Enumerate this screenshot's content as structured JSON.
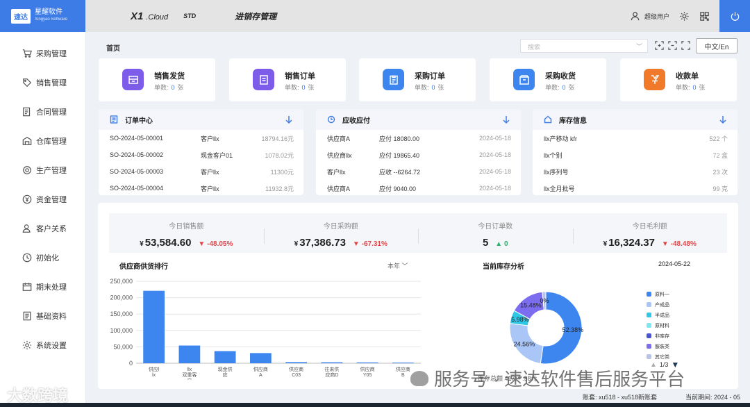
{
  "logo": {
    "badge": "速达",
    "name": "星耀软件",
    "tagline": "Xingyao Software"
  },
  "header": {
    "brand": "X1",
    "brand_suffix": ".Cloud",
    "edition": "STD",
    "module": "进销存管理",
    "user": "超级用户",
    "icons": [
      "user-icon",
      "gear-icon",
      "qrcode-icon",
      "power-icon"
    ]
  },
  "sidebar": {
    "items": [
      {
        "label": "采购管理",
        "icon": "cart-icon"
      },
      {
        "label": "销售管理",
        "icon": "tag-icon"
      },
      {
        "label": "合同管理",
        "icon": "contract-icon"
      },
      {
        "label": "仓库管理",
        "icon": "warehouse-icon"
      },
      {
        "label": "生产管理",
        "icon": "production-icon"
      },
      {
        "label": "资金管理",
        "icon": "money-icon"
      },
      {
        "label": "客户关系",
        "icon": "customer-icon"
      },
      {
        "label": "初始化",
        "icon": "init-icon"
      },
      {
        "label": "期末处理",
        "icon": "calendar-icon"
      },
      {
        "label": "基础资料",
        "icon": "document-icon"
      },
      {
        "label": "系统设置",
        "icon": "settings-icon"
      }
    ]
  },
  "breadcrumb": "首页",
  "search": {
    "placeholder": "搜索"
  },
  "language_button": "中文/En",
  "quick_cards": [
    {
      "title": "销售发货",
      "count_label": "单数:",
      "count": "0",
      "unit": "张",
      "color": "#7c5ce8"
    },
    {
      "title": "销售订单",
      "count_label": "单数:",
      "count": "0",
      "unit": "张",
      "color": "#7c5ce8"
    },
    {
      "title": "采购订单",
      "count_label": "单数:",
      "count": "0",
      "unit": "张",
      "color": "#3d86f0"
    },
    {
      "title": "采购收货",
      "count_label": "单数:",
      "count": "0",
      "unit": "张",
      "color": "#3d86f0"
    },
    {
      "title": "收款单",
      "count_label": "单数:",
      "count": "0",
      "unit": "张",
      "color": "#f0792a"
    }
  ],
  "panels": {
    "orders": {
      "title": "订单中心",
      "rows": [
        [
          "SO-2024-05-00001",
          "客户llx",
          "18794.16元"
        ],
        [
          "SO-2024-05-00002",
          "现金客户01",
          "1078.02元"
        ],
        [
          "SO-2024-05-00003",
          "客户llx",
          "11300元"
        ],
        [
          "SO-2024-05-00004",
          "客户llx",
          "11932.8元"
        ]
      ]
    },
    "receivables": {
      "title": "应收应付",
      "rows": [
        [
          "供应商A",
          "应付 18080.00",
          "2024-05-18"
        ],
        [
          "供应商llx",
          "应付 19865.40",
          "2024-05-18"
        ],
        [
          "客户llx",
          "应收 --6264.72",
          "2024-05-18"
        ],
        [
          "供应商A",
          "应付 9040.00",
          "2024-05-18"
        ]
      ]
    },
    "inventory": {
      "title": "库存信息",
      "rows": [
        [
          "llx产移动 kfr",
          "522 个"
        ],
        [
          "llx个别",
          "72 盒"
        ],
        [
          "llx序列号",
          "23 次"
        ],
        [
          "llx全月批号",
          "99 克"
        ]
      ]
    }
  },
  "stats": [
    {
      "label": "今日销售额",
      "currency": "¥",
      "value": "53,584.60",
      "change": "-48.05%",
      "direction": "down"
    },
    {
      "label": "今日采购额",
      "currency": "¥",
      "value": "37,386.73",
      "change": "-67.31%",
      "direction": "down"
    },
    {
      "label": "今日订单数",
      "currency": "",
      "value": "5",
      "change": "0",
      "direction": "up"
    },
    {
      "label": "今日毛利额",
      "currency": "¥",
      "value": "16,324.37",
      "change": "-48.48%",
      "direction": "down"
    }
  ],
  "supplier_chart_title": "供应商供货排行",
  "supplier_period": "本年",
  "inventory_chart_title": "当前库存分析",
  "inventory_date": "2024-05-22",
  "inventory_total": "库存总额 417***.98元",
  "legend_page": "1/3",
  "status_bar": {
    "account": "账套: xu518 - xu518新账套",
    "period": "当前期间: 2024 - 05"
  },
  "watermark": {
    "wechat": "服务号 · 速达软件售后服务平台",
    "source": "大数跨境"
  },
  "chart_data": [
    {
      "type": "bar",
      "title": "供应商供货排行",
      "categories": [
        "供应l lx",
        "llx 双重客户",
        "现金供应",
        "供应商 A",
        "供应商 C03",
        "往来供应商D",
        "供应商 Y05",
        "供应商 B"
      ],
      "category_lines": [
        [
          "供应l",
          "lx"
        ],
        [
          "llx",
          "双重客",
          "户"
        ],
        [
          "现金供",
          "应"
        ],
        [
          "供应商",
          "A"
        ],
        [
          "供应商",
          "C03"
        ],
        [
          "往来供",
          "应商D"
        ],
        [
          "供应商",
          "Y05"
        ],
        [
          "供应商",
          "B"
        ]
      ],
      "values": [
        221000,
        54000,
        37000,
        31000,
        3500,
        3000,
        2500,
        2000
      ],
      "y_ticks": [
        "0",
        "50,000",
        "100,000",
        "150,000",
        "200,000",
        "250,000"
      ],
      "ylim": [
        0,
        250000
      ],
      "color": "#3d86f0",
      "grid": true
    },
    {
      "type": "pie",
      "title": "当前库存分析",
      "labels": [
        "原料一",
        "产成品",
        "半成品",
        "原材料",
        "非库存",
        "服装类",
        "其它类"
      ],
      "values": [
        52.38,
        24.56,
        5.98,
        0,
        0,
        15.48,
        1.6
      ],
      "value_labels": [
        "52.38%",
        "24.56%",
        "5.98%",
        "",
        "",
        "15.48%",
        "0%"
      ],
      "colors": [
        "#3d86f0",
        "#a9c6f7",
        "#2ec7e6",
        "#7ee8f0",
        "#4a55d6",
        "#7b6cf0",
        "#b8c4e8"
      ],
      "legend_position": "right",
      "donut": true
    }
  ]
}
